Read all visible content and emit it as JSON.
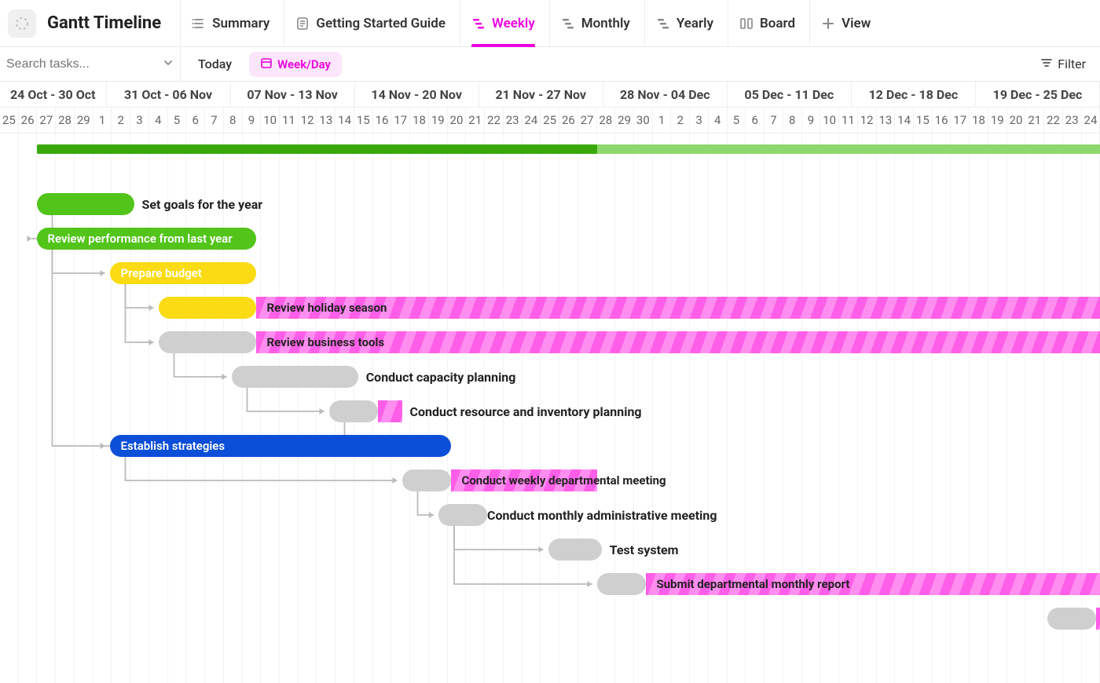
{
  "header": {
    "title": "Gantt Timeline",
    "tabs": [
      {
        "label": "Summary",
        "icon": "list"
      },
      {
        "label": "Getting Started Guide",
        "icon": "doc"
      },
      {
        "label": "Weekly",
        "icon": "gantt",
        "active": true
      },
      {
        "label": "Monthly",
        "icon": "gantt"
      },
      {
        "label": "Yearly",
        "icon": "gantt"
      },
      {
        "label": "Board",
        "icon": "board"
      },
      {
        "label": "View",
        "icon": "plus"
      }
    ]
  },
  "toolbar": {
    "search_placeholder": "Search tasks...",
    "today_label": "Today",
    "zoom_label": "Week/Day",
    "filter_label": "Filter"
  },
  "timeline": {
    "colors": {
      "green": "#52c41a",
      "green_dark": "#3aa80b",
      "yellow": "#fadb14",
      "grey": "#cfcfcf",
      "blue": "#0b4ed8",
      "magenta": "#ff5ee8",
      "accent": "#ec00e0"
    },
    "day_width": 31,
    "start_day_index": 25,
    "weeks": [
      {
        "label": "24 Oct - 30 Oct",
        "start": 24,
        "end": 30
      },
      {
        "label": "31 Oct - 06 Nov",
        "start": 31,
        "end": 37
      },
      {
        "label": "07 Nov - 13 Nov",
        "start": 38,
        "end": 44
      },
      {
        "label": "14 Nov - 20 Nov",
        "start": 45,
        "end": 51
      },
      {
        "label": "21 Nov - 27 Nov",
        "start": 52,
        "end": 58
      },
      {
        "label": "28 Nov - 04 Dec",
        "start": 59,
        "end": 65
      },
      {
        "label": "05 Dec - 11 Dec",
        "start": 66,
        "end": 72
      },
      {
        "label": "12 Dec - 18 Dec",
        "start": 73,
        "end": 79
      },
      {
        "label": "19 Dec - 25 Dec",
        "start": 80,
        "end": 86
      }
    ],
    "days": [
      "25",
      "26",
      "27",
      "28",
      "29",
      "1",
      "2",
      "3",
      "4",
      "5",
      "6",
      "7",
      "8",
      "9",
      "10",
      "11",
      "12",
      "13",
      "14",
      "15",
      "16",
      "17",
      "18",
      "19",
      "20",
      "21",
      "22",
      "23",
      "24",
      "25",
      "26",
      "27",
      "28",
      "29",
      "30",
      "1",
      "2",
      "3",
      "4",
      "5",
      "6",
      "7",
      "8",
      "9",
      "10",
      "11",
      "12",
      "13",
      "14",
      "15",
      "16",
      "17",
      "18",
      "19",
      "20",
      "21",
      "22",
      "23",
      "24"
    ]
  },
  "summary": {
    "start": 1.5,
    "end": 70,
    "progress_end": 24.5
  },
  "tasks": [
    {
      "id": "goals",
      "label": "Set goals for the year",
      "start": 1.5,
      "dur": 4,
      "color": "green",
      "row": 1,
      "label_out": true
    },
    {
      "id": "review",
      "label": "Review performance from last year",
      "start": 1.5,
      "dur": 9,
      "color": "green",
      "row": 2,
      "label_out": false
    },
    {
      "id": "budget",
      "label": "Prepare budget",
      "start": 4.5,
      "dur": 6,
      "color": "yellow",
      "row": 3,
      "label_out": false
    },
    {
      "id": "holiday_g",
      "label": "",
      "start": 6.5,
      "dur": 4,
      "color": "yellow",
      "row": 4,
      "label_out": false
    },
    {
      "id": "holiday_s",
      "label": "Review holiday season",
      "start": 10.5,
      "dur": 40,
      "color": "stripe",
      "row": 4,
      "label_out": false,
      "open_end": true
    },
    {
      "id": "btools_g",
      "label": "",
      "start": 6.5,
      "dur": 4,
      "color": "grey",
      "row": 5,
      "label_out": false
    },
    {
      "id": "btools_s",
      "label": "Review business tools",
      "start": 10.5,
      "dur": 40,
      "color": "stripe",
      "row": 5,
      "label_out": false,
      "open_end": true
    },
    {
      "id": "capacity",
      "label": "Conduct capacity planning",
      "start": 9.5,
      "dur": 5.2,
      "color": "grey",
      "row": 6,
      "label_out": true
    },
    {
      "id": "resinv_g",
      "label": "",
      "start": 13.5,
      "dur": 2,
      "color": "grey",
      "row": 7,
      "label_out": false
    },
    {
      "id": "resinv_s",
      "label": "Conduct resource and inventory planning",
      "start": 15.5,
      "dur": 1,
      "color": "stripe",
      "row": 7,
      "label_out": true,
      "open_end": false
    },
    {
      "id": "strat",
      "label": "Establish strategies",
      "start": 4.5,
      "dur": 14,
      "color": "blue",
      "row": 8,
      "label_out": false
    },
    {
      "id": "weekly_g",
      "label": "",
      "start": 16.5,
      "dur": 2,
      "color": "grey",
      "row": 9,
      "label_out": false
    },
    {
      "id": "weekly_s",
      "label": "Conduct weekly departmental meeting",
      "start": 18.5,
      "dur": 6,
      "color": "stripe",
      "row": 9,
      "label_out": false
    },
    {
      "id": "monthly_g",
      "label": "",
      "start": 18,
      "dur": 2,
      "color": "grey",
      "row": 10,
      "label_out": false
    },
    {
      "id": "monthly_s",
      "label": "Conduct monthly administrative meeting",
      "start": 20,
      "dur": 10,
      "color": "stripe",
      "row": 10,
      "label_out": true,
      "open_end": false,
      "label_only": true
    },
    {
      "id": "testsys",
      "label": "Test system",
      "start": 22.5,
      "dur": 2.2,
      "color": "grey",
      "row": 11,
      "label_out": true
    },
    {
      "id": "report_g",
      "label": "",
      "start": 24.5,
      "dur": 2,
      "color": "grey",
      "row": 12,
      "label_out": false
    },
    {
      "id": "report_s",
      "label": "Submit departmental monthly report",
      "start": 26.5,
      "dur": 30,
      "color": "stripe",
      "row": 12,
      "label_out": false,
      "open_end": true
    },
    {
      "id": "far",
      "label": "",
      "start": 43,
      "dur": 2,
      "color": "grey",
      "row": 13,
      "label_out": false
    },
    {
      "id": "far_s",
      "label": "",
      "start": 45,
      "dur": 2,
      "color": "stripe",
      "row": 13,
      "label_out": false,
      "open_end": true
    }
  ],
  "dependencies": [
    {
      "from": "goals",
      "to": "review"
    },
    {
      "from": "review",
      "to": "budget"
    },
    {
      "from": "review",
      "to": "strat"
    },
    {
      "from": "budget",
      "to": "holiday_g"
    },
    {
      "from": "budget",
      "to": "btools_g"
    },
    {
      "from": "btools_g",
      "to": "capacity"
    },
    {
      "from": "capacity",
      "to": "resinv_g"
    },
    {
      "from": "resinv_g",
      "to": "strat",
      "reverse": true
    },
    {
      "from": "strat",
      "to": "weekly_g"
    },
    {
      "from": "weekly_g",
      "to": "monthly_g"
    },
    {
      "from": "monthly_g",
      "to": "testsys"
    },
    {
      "from": "monthly_g",
      "to": "report_g"
    }
  ]
}
